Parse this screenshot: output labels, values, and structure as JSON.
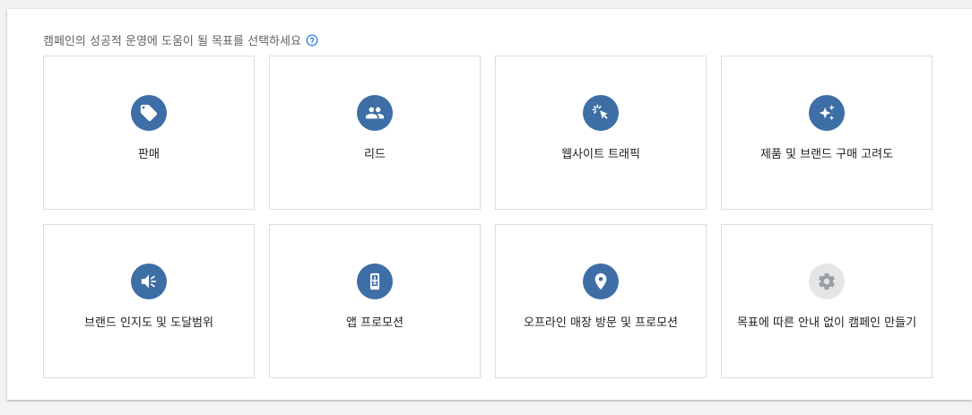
{
  "header": {
    "title": "캠페인의 성공적 운영에 도움이 될 목표를 선택하세요"
  },
  "goals": [
    {
      "label": "판매",
      "icon": "tag-icon"
    },
    {
      "label": "리드",
      "icon": "people-icon"
    },
    {
      "label": "웹사이트 트래픽",
      "icon": "cursor-click-icon"
    },
    {
      "label": "제품 및 브랜드 구매 고려도",
      "icon": "sparkle-icon"
    },
    {
      "label": "브랜드 인지도 및 도달범위",
      "icon": "megaphone-icon"
    },
    {
      "label": "앱 프로모션",
      "icon": "phone-download-icon"
    },
    {
      "label": "오프라인 매장 방문 및 프로모션",
      "icon": "location-pin-icon"
    },
    {
      "label": "목표에 따른 안내 없이 캠페인 만들기",
      "icon": "gear-icon"
    }
  ],
  "colors": {
    "accent": "#3d6ea6",
    "muted_icon_bg": "#e4e5e7",
    "help_icon": "#1a73e8"
  }
}
